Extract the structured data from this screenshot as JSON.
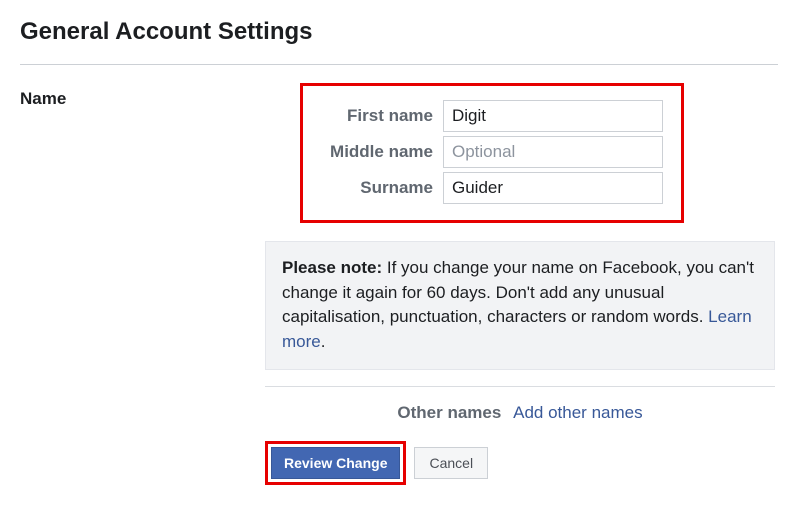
{
  "header": {
    "title": "General Account Settings"
  },
  "name_section": {
    "label": "Name",
    "fields": {
      "first_name": {
        "label": "First name",
        "value": "Digit"
      },
      "middle_name": {
        "label": "Middle name",
        "placeholder": "Optional",
        "value": ""
      },
      "surname": {
        "label": "Surname",
        "value": "Guider"
      }
    },
    "note": {
      "bold": "Please note:",
      "text": " If you change your name on Facebook, you can't change it again for 60 days. Don't add any unusual capitalisation, punctuation, characters or random words. ",
      "link": "Learn more",
      "after": "."
    },
    "other_names": {
      "label": "Other names",
      "link": "Add other names"
    },
    "buttons": {
      "review": "Review Change",
      "cancel": "Cancel"
    }
  }
}
